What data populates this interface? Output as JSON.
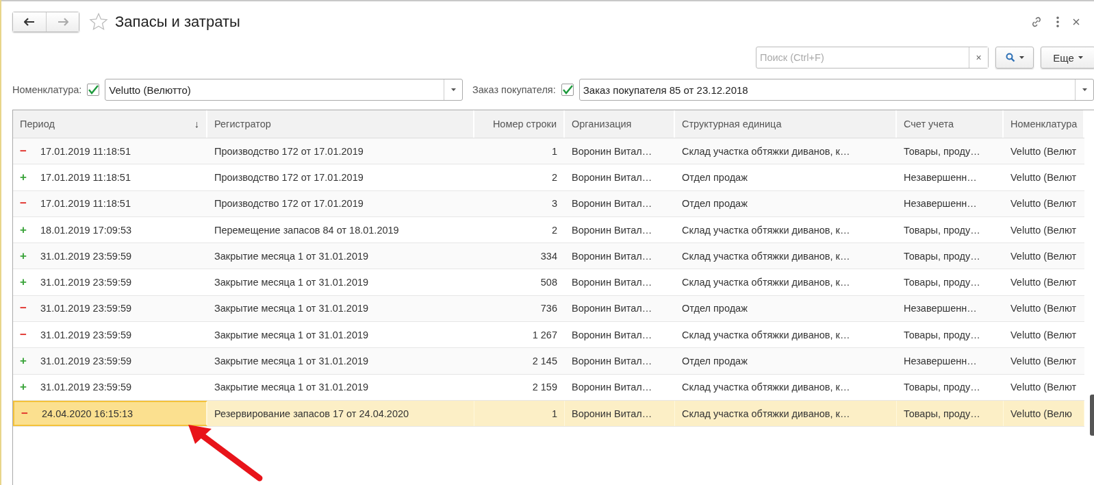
{
  "window": {
    "title": "Запасы и затраты"
  },
  "search": {
    "placeholder": "Поиск (Ctrl+F)",
    "clear": "×"
  },
  "more_button": "Еще",
  "filters": [
    {
      "label": "Номенклатура:",
      "checked": true,
      "value": "Velutto (Велютто)"
    },
    {
      "label": "Заказ покупателя:",
      "checked": true,
      "value": "Заказ покупателя 85 от 23.12.2018"
    }
  ],
  "table": {
    "columns": [
      {
        "label": "Период",
        "sort": "↓"
      },
      {
        "label": "Регистратор"
      },
      {
        "label": "Номер строки"
      },
      {
        "label": "Организация"
      },
      {
        "label": "Структурная единица"
      },
      {
        "label": "Счет учета"
      },
      {
        "label": "Номенклатура"
      }
    ],
    "rows": [
      {
        "kind": "expense",
        "sign": "−",
        "selected": false,
        "cells": [
          "17.01.2019 11:18:51",
          "Производство 172 от 17.01.2019",
          "1",
          "Воронин Витал…",
          "Склад участка обтяжки диванов, к…",
          "Товары, проду…",
          "Velutto (Велют"
        ]
      },
      {
        "kind": "receipt",
        "sign": "+",
        "selected": false,
        "cells": [
          "17.01.2019 11:18:51",
          "Производство 172 от 17.01.2019",
          "2",
          "Воронин Витал…",
          "Отдел продаж",
          "Незавершенн…",
          "Velutto (Велют"
        ]
      },
      {
        "kind": "expense",
        "sign": "−",
        "selected": false,
        "cells": [
          "17.01.2019 11:18:51",
          "Производство 172 от 17.01.2019",
          "3",
          "Воронин Витал…",
          "Отдел продаж",
          "Незавершенн…",
          "Velutto (Велют"
        ]
      },
      {
        "kind": "receipt",
        "sign": "+",
        "selected": false,
        "cells": [
          "18.01.2019 17:09:53",
          "Перемещение запасов 84 от 18.01.2019",
          "2",
          "Воронин Витал…",
          "Склад участка обтяжки диванов, к…",
          "Товары, проду…",
          "Velutto (Велют"
        ]
      },
      {
        "kind": "receipt",
        "sign": "+",
        "selected": false,
        "cells": [
          "31.01.2019 23:59:59",
          "Закрытие месяца 1 от 31.01.2019",
          "334",
          "Воронин Витал…",
          "Склад участка обтяжки диванов, к…",
          "Товары, проду…",
          "Velutto (Велют"
        ]
      },
      {
        "kind": "receipt",
        "sign": "+",
        "selected": false,
        "cells": [
          "31.01.2019 23:59:59",
          "Закрытие месяца 1 от 31.01.2019",
          "508",
          "Воронин Витал…",
          "Склад участка обтяжки диванов, к…",
          "Товары, проду…",
          "Velutto (Велют"
        ]
      },
      {
        "kind": "expense",
        "sign": "−",
        "selected": false,
        "cells": [
          "31.01.2019 23:59:59",
          "Закрытие месяца 1 от 31.01.2019",
          "736",
          "Воронин Витал…",
          "Отдел продаж",
          "Незавершенн…",
          "Velutto (Велют"
        ]
      },
      {
        "kind": "expense",
        "sign": "−",
        "selected": false,
        "cells": [
          "31.01.2019 23:59:59",
          "Закрытие месяца 1 от 31.01.2019",
          "1 267",
          "Воронин Витал…",
          "Склад участка обтяжки диванов, к…",
          "Товары, проду…",
          "Velutto (Велют"
        ]
      },
      {
        "kind": "receipt",
        "sign": "+",
        "selected": false,
        "cells": [
          "31.01.2019 23:59:59",
          "Закрытие месяца 1 от 31.01.2019",
          "2 145",
          "Воронин Витал…",
          "Отдел продаж",
          "Незавершенн…",
          "Velutto (Велют"
        ]
      },
      {
        "kind": "receipt",
        "sign": "+",
        "selected": false,
        "cells": [
          "31.01.2019 23:59:59",
          "Закрытие месяца 1 от 31.01.2019",
          "2 159",
          "Воронин Витал…",
          "Склад участка обтяжки диванов, к…",
          "Товары, проду…",
          "Velutto (Велют"
        ]
      },
      {
        "kind": "expense",
        "sign": "−",
        "selected": true,
        "cells": [
          "24.04.2020 16:15:13",
          "Резервирование запасов 17 от 24.04.2020",
          "1",
          "Воронин Витал…",
          "Склад участка обтяжки диванов, к…",
          "Товары, проду…",
          "Velutto (Велю"
        ]
      }
    ]
  }
}
